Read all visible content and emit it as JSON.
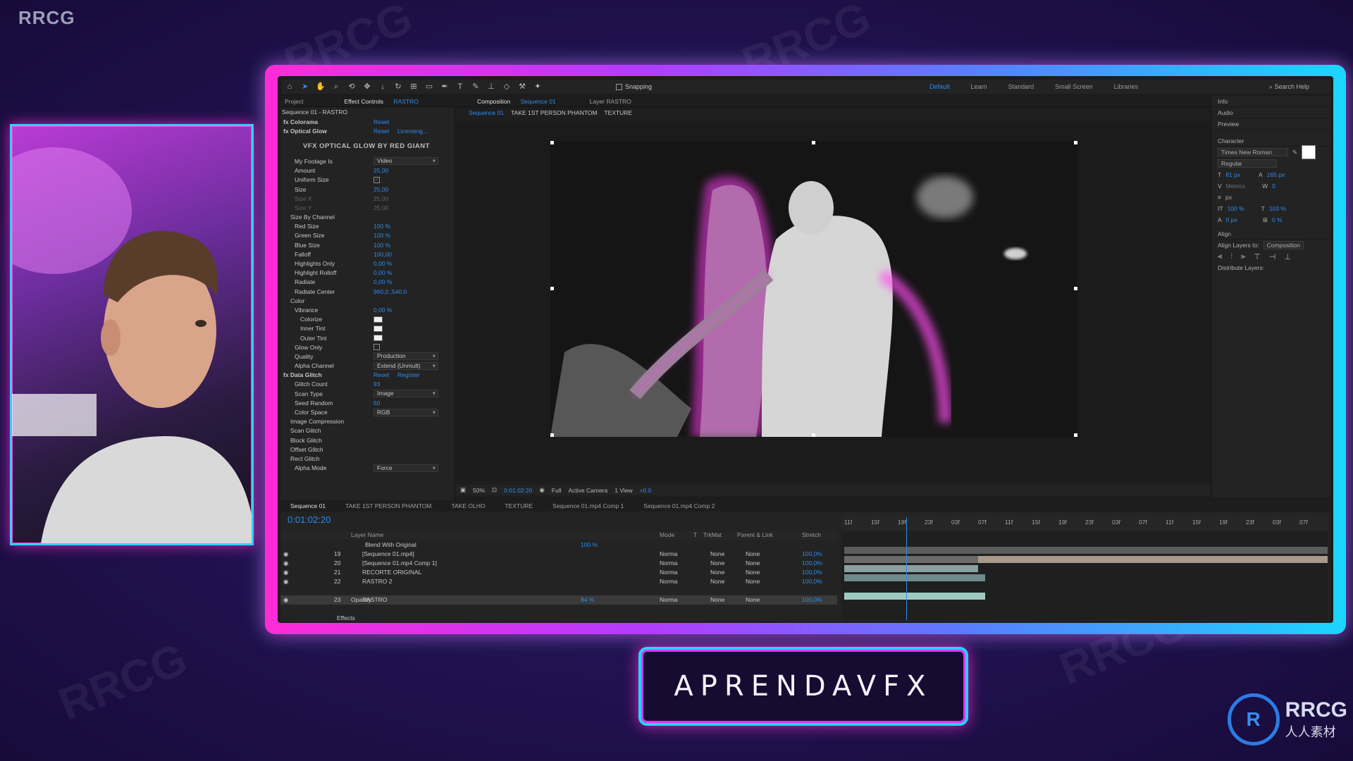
{
  "overlay": {
    "corner_watermark": "RRCG",
    "brand_title": "APRENDAVFX",
    "logo_text": "RRCG",
    "logo_sub": "人人素材",
    "watermark_text": "RRCG",
    "accent_pink": "#ff2bd6",
    "accent_cyan": "#1ad6ff"
  },
  "toolbar": {
    "snapping_label": "Snapping",
    "workspaces": [
      "Default",
      "Learn",
      "Standard",
      "Small Screen",
      "Libraries"
    ],
    "active_workspace": "Default",
    "search_placeholder": "Search Help"
  },
  "effect_controls": {
    "project_tab": "Project",
    "tab_label": "Effect Controls",
    "tab_layer": "RASTRO",
    "header": "Sequence 01 - RASTRO",
    "plugin_banner": "VFX OPTICAL GLOW BY RED GIANT",
    "rows": [
      {
        "name": "Colorama",
        "value": "Reset",
        "kind": "fx"
      },
      {
        "name": "Optical Glow",
        "value": "Reset",
        "extra": "Licensing...",
        "kind": "fx"
      },
      {
        "name": "My Footage Is",
        "value": "Video",
        "kind": "drop"
      },
      {
        "name": "Amount",
        "value": "25,00",
        "kind": "val"
      },
      {
        "name": "Uniform Size",
        "value": "✓",
        "kind": "check"
      },
      {
        "name": "Size",
        "value": "25,00",
        "kind": "val"
      },
      {
        "name": "Size X",
        "value": "25,00",
        "kind": "dim"
      },
      {
        "name": "Size Y",
        "value": "25,00",
        "kind": "dim"
      },
      {
        "name": "Size By Channel",
        "value": "",
        "kind": "group"
      },
      {
        "name": "Red Size",
        "value": "100 %",
        "kind": "val"
      },
      {
        "name": "Green Size",
        "value": "100 %",
        "kind": "val"
      },
      {
        "name": "Blue Size",
        "value": "100 %",
        "kind": "val"
      },
      {
        "name": "Falloff",
        "value": "100,00",
        "kind": "val"
      },
      {
        "name": "Highlights Only",
        "value": "0,00 %",
        "kind": "val"
      },
      {
        "name": "Highlight Rolloff",
        "value": "0,00 %",
        "kind": "val"
      },
      {
        "name": "Radiate",
        "value": "0,00 %",
        "kind": "val"
      },
      {
        "name": "Radiate Center",
        "value": "960,0 ,540,0",
        "kind": "val"
      },
      {
        "name": "Color",
        "value": "",
        "kind": "group"
      },
      {
        "name": "Vibrance",
        "value": "0,00 %",
        "kind": "val"
      },
      {
        "name": "Colorize",
        "value": "",
        "kind": "swatch"
      },
      {
        "name": "Inner Tint",
        "value": "",
        "kind": "swatch"
      },
      {
        "name": "Outer Tint",
        "value": "",
        "kind": "swatch"
      },
      {
        "name": "Glow Only",
        "value": "",
        "kind": "check"
      },
      {
        "name": "Quality",
        "value": "Production",
        "kind": "drop"
      },
      {
        "name": "Alpha Channel",
        "value": "Extend (Unmult)",
        "kind": "drop"
      },
      {
        "name": "Data Glitch",
        "value": "Reset",
        "extra": "Register",
        "kind": "fx"
      },
      {
        "name": "Glitch Count",
        "value": "93",
        "kind": "val"
      },
      {
        "name": "Scan Type",
        "value": "Image",
        "kind": "drop"
      },
      {
        "name": "Seed Random",
        "value": "50",
        "kind": "val"
      },
      {
        "name": "Color Space",
        "value": "RGB",
        "kind": "drop"
      },
      {
        "name": "Image Compression",
        "value": "",
        "kind": "group"
      },
      {
        "name": "Scan Glitch",
        "value": "",
        "kind": "group"
      },
      {
        "name": "Block Glitch",
        "value": "",
        "kind": "group"
      },
      {
        "name": "Offset Glitch",
        "value": "",
        "kind": "group"
      },
      {
        "name": "Rect Glitch",
        "value": "",
        "kind": "group"
      },
      {
        "name": "Alpha Mode",
        "value": "Force",
        "kind": "drop"
      }
    ]
  },
  "composition": {
    "tab_label": "Composition",
    "tab_comp": "Sequence 01",
    "layer_tab": "Layer RASTRO",
    "breadcrumbs": [
      "Sequence 01",
      "TAKE 1ST PERSON PHANTOM",
      "TEXTURE"
    ],
    "zoom": "50%",
    "timecode": "0:01:02:20",
    "resolution": "Full",
    "camera": "Active Camera",
    "view": "1 View",
    "exposure": "+0.0"
  },
  "right_panel": {
    "sections": [
      "Info",
      "Audio",
      "Preview"
    ],
    "character_title": "Character",
    "font": "Times New Roman",
    "style": "Regular",
    "font_size": "81 px",
    "leading": "165 px",
    "tracking_label": "Metrics",
    "tracking": "0",
    "unit": "px",
    "vscale": "100 %",
    "hscale": "103 %",
    "baseline": "0 px",
    "tsume": "0 %",
    "align_title": "Align",
    "align_to_label": "Align Layers to:",
    "align_to_value": "Composition",
    "distribute_label": "Distribute Layers:"
  },
  "timeline": {
    "tabs": [
      "Sequence 01",
      "TAKE 1ST PERSON PHANTOM",
      "TAKE OLHO",
      "TEXTURE",
      "Sequence 01.mp4 Comp 1",
      "Sequence 01.mp4 Comp 2"
    ],
    "current_time": "0:01:02:20",
    "columns": [
      "Layer Name",
      "Mode",
      "T",
      "TrkMat",
      "Parent & Link",
      "Stretch"
    ],
    "blend_row": {
      "name": "Blend With Original",
      "value": "100 %"
    },
    "layers": [
      {
        "num": "19",
        "name": "[Sequence 01.mp4]",
        "mode": "Norma",
        "trkmat": "None",
        "parent": "None",
        "stretch": "100,0%"
      },
      {
        "num": "20",
        "name": "[Sequence 01.mp4 Comp 1]",
        "mode": "Norma",
        "trkmat": "None",
        "parent": "None",
        "stretch": "100,0%"
      },
      {
        "num": "21",
        "name": "RECORTE ORIGINAL",
        "mode": "Norma",
        "trkmat": "None",
        "parent": "None",
        "stretch": "100,0%"
      },
      {
        "num": "22",
        "name": "RASTRO 2",
        "mode": "Norma",
        "trkmat": "None",
        "parent": "None",
        "stretch": "100,0%"
      },
      {
        "num": "23",
        "name": "RASTRO",
        "mode": "Norma",
        "trkmat": "None",
        "parent": "None",
        "stretch": "100,0%"
      }
    ],
    "opacity_row": {
      "name": "Opacity",
      "value": "84 %"
    },
    "effects_row": "Effects",
    "ruler": [
      "11f",
      "15f",
      "19f",
      "23f",
      "03f",
      "07f",
      "11f",
      "15f",
      "19f",
      "23f",
      "03f",
      "07f",
      "11f",
      "15f",
      "19f",
      "23f",
      "03f",
      "07f"
    ]
  }
}
